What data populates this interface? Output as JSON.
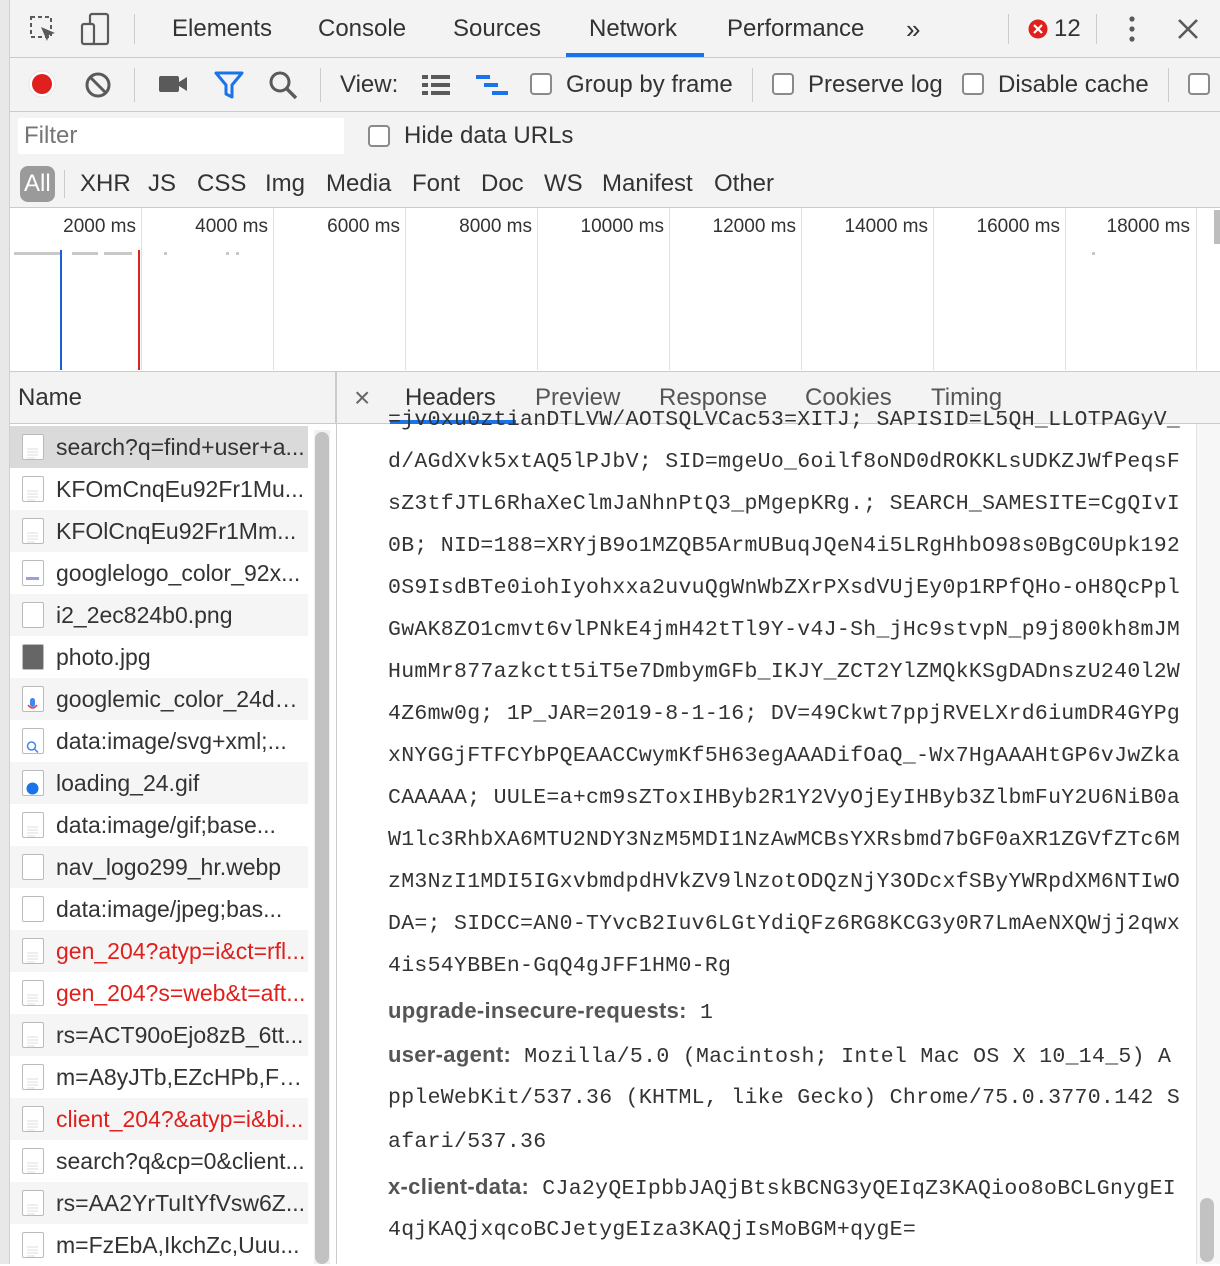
{
  "toolbar_tabs": [
    "Elements",
    "Console",
    "Sources",
    "Network",
    "Performance"
  ],
  "more_tabs": "»",
  "error_count": "12",
  "view_label": "View:",
  "checkboxes": {
    "group_by_frame": "Group by frame",
    "preserve_log": "Preserve log",
    "disable_cache": "Disable cache",
    "hide_data_urls": "Hide data URLs"
  },
  "filter_placeholder": "Filter",
  "types": [
    "All",
    "XHR",
    "JS",
    "CSS",
    "Img",
    "Media",
    "Font",
    "Doc",
    "WS",
    "Manifest",
    "Other"
  ],
  "timeline_ticks": [
    "2000 ms",
    "4000 ms",
    "6000 ms",
    "8000 ms",
    "10000 ms",
    "12000 ms",
    "14000 ms",
    "16000 ms",
    "18000 ms"
  ],
  "name_header": "Name",
  "requests": [
    {
      "name": "search?q=find+user+a...",
      "error": false,
      "selected": true
    },
    {
      "name": "KFOmCnqEu92Fr1Mu...",
      "error": false
    },
    {
      "name": "KFOlCnqEu92Fr1Mm...",
      "error": false
    },
    {
      "name": "googlelogo_color_92x...",
      "error": false
    },
    {
      "name": "i2_2ec824b0.png",
      "error": false
    },
    {
      "name": "photo.jpg",
      "error": false
    },
    {
      "name": "googlemic_color_24dp...",
      "error": false
    },
    {
      "name": "data:image/svg+xml;...",
      "error": false
    },
    {
      "name": "loading_24.gif",
      "error": false
    },
    {
      "name": "data:image/gif;base...",
      "error": false
    },
    {
      "name": "nav_logo299_hr.webp",
      "error": false
    },
    {
      "name": "data:image/jpeg;bas...",
      "error": false
    },
    {
      "name": "gen_204?atyp=i&ct=rfl...",
      "error": true
    },
    {
      "name": "gen_204?s=web&t=aft...",
      "error": true
    },
    {
      "name": "rs=ACT90oEjo8zB_6tt...",
      "error": false
    },
    {
      "name": "m=A8yJTb,EZcHPb,F0...",
      "error": false
    },
    {
      "name": "client_204?&atyp=i&bi...",
      "error": true
    },
    {
      "name": "search?q&cp=0&client...",
      "error": false
    },
    {
      "name": "rs=AA2YrTuItYfVsw6Z...",
      "error": false
    },
    {
      "name": "m=FzEbA,IkchZc,Uuu...",
      "error": false
    }
  ],
  "detail_tabs": [
    "Headers",
    "Preview",
    "Response",
    "Cookies",
    "Timing"
  ],
  "close_glyph": "×",
  "cookie_lines": [
    "=jv0xu0ztianDTLVW/AOTSQLVCac53=XITJ; SAPISID=L5QH_LLOTPAGyV_",
    "d/AGdXvk5xtAQ5lPJbV; SID=mgeUo_6oilf8oND0dROKKLsUDKZJWfPeqsF",
    "sZ3tfJTL6RhaXeClmJaNhnPtQ3_pMgepKRg.; SEARCH_SAMESITE=CgQIvI",
    "0B; NID=188=XRYjB9o1MZQB5ArmUBuqJQeN4i5LRgHhbO98s0BgC0Upk192",
    "0S9IsdBTe0iohIyohxxa2uvuQgWnWbZXrPXsdVUjEy0p1RPfQHo-oH8QcPpl",
    "GwAK8ZO1cmvt6vlPNkE4jmH42tTl9Y-v4J-Sh_jHc9stvpN_p9j800kh8mJM",
    "HumMr877azkctt5iT5e7DmbymGFb_IKJY_ZCT2YlZMQkKSgDADnszU240l2W",
    "4Z6mw0g; 1P_JAR=2019-8-1-16; DV=49Ckwt7ppjRVELXrd6iumDR4GYPg",
    "xNYGGjFTFCYbPQEAACCwymKf5H63egAAADifOaQ_-Wx7HgAAAHtGP6vJwZka",
    "CAAAAA; UULE=a+cm9sZToxIHByb2R1Y2VyOjEyIHByb3ZlbmFuY2U6NiB0a",
    "W1lc3RhbXA6MTU2NDY3NzM5MDI1NzAwMCBsYXRsbmd7bGF0aXR1ZGVfZTc6M",
    "zM3NzI1MDI5IGxvbmdpdHVkZV9lNzotODQzNjY3ODcxfSByYWRpdXM6NTIwO",
    "DA=; SIDCC=AN0-TYvcB2Iuv6LGtYdiQFz6RG8KCG3y0R7LmAeNXQWjj2qwx",
    "4is54YBBEn-GqQ4gJFF1HM0-Rg"
  ],
  "headers": [
    {
      "key": "upgrade-insecure-requests:",
      "lines": [
        " 1"
      ]
    },
    {
      "key": "user-agent:",
      "lines": [
        " Mozilla/5.0 (Macintosh; Intel Mac OS X 10_14_5) A",
        "ppleWebKit/537.36 (KHTML, like Gecko) Chrome/75.0.3770.142 S",
        "afari/537.36"
      ]
    },
    {
      "key": "x-client-data:",
      "lines": [
        " CJa2yQEIpbbJAQjBtskBCNG3yQEIqZ3KAQioo8oBCLGnygEI",
        "4qjKAQjxqcoBCJetygEIza3KAQjIsMoBGM+qygE="
      ]
    }
  ],
  "colors": {
    "accent": "#1a73e8",
    "record": "#e0201d",
    "error_text": "#e0201d",
    "filter_icon": "#1a73e8"
  }
}
